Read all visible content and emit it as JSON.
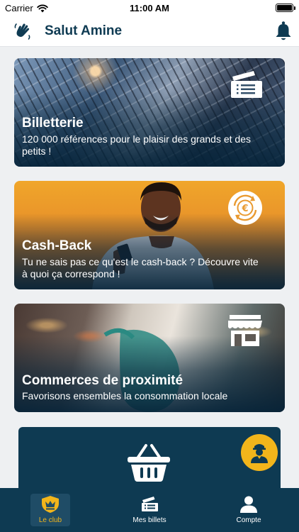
{
  "status": {
    "carrier": "Carrier",
    "time": "11:00 AM"
  },
  "header": {
    "title": "Salut Amine",
    "left_icon": "waving-hand-icon",
    "right_icon": "bell-icon"
  },
  "cards": [
    {
      "title": "Billetterie",
      "description": "120 000 références pour le plaisir des grands et des petits !",
      "icon": "ticket-icon"
    },
    {
      "title": "Cash-Back",
      "description": "Tu ne sais pas ce qu'est le cash-back ? Découvre vite à quoi ça correspond !",
      "icon": "euro-cycle-icon"
    },
    {
      "title": "Commerces de proximité",
      "description": "Favorisons ensembles la consommation locale",
      "icon": "storefront-icon"
    }
  ],
  "bottom_panel": {
    "icon": "shopping-basket-icon"
  },
  "support_button": {
    "icon": "concierge-icon"
  },
  "tabs": [
    {
      "label": "Le club",
      "icon": "club-badge-icon",
      "active": true
    },
    {
      "label": "Mes billets",
      "icon": "tickets-icon",
      "active": false
    },
    {
      "label": "Compte",
      "icon": "user-icon",
      "active": false
    }
  ],
  "colors": {
    "brand_navy": "#0e3a52",
    "accent_yellow": "#f2b51b",
    "background": "#eef0f2"
  }
}
